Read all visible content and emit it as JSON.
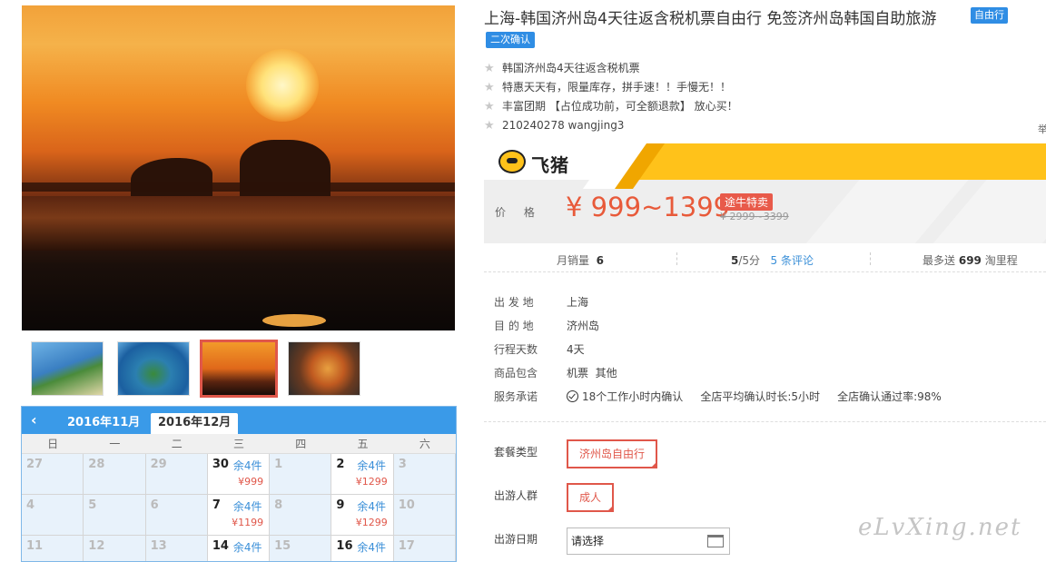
{
  "product": {
    "title": "上海-韩国济州岛4天往返含税机票自由行 免签济州岛韩国自助旅游",
    "badge_free": "自由行",
    "badge_confirm": "二次确认",
    "bullets": [
      "韩国济州岛4天往返含税机票",
      "特惠天天有，限量库存，拼手速！！手慢无！！",
      "丰富团期 【占位成功前，可全额退款】 放心买！",
      "210240278 wangjing3"
    ],
    "edge_text": "举"
  },
  "pricing": {
    "brand_logo_text": "飞猪",
    "label": "价 格",
    "range": "¥ 999~1399",
    "promo_tag": "途牛特卖",
    "original_range": "¥ 2999~3399"
  },
  "stats": {
    "monthly_sales_label": "月销量",
    "monthly_sales_value": "6",
    "rating_value": "5",
    "rating_suffix": "/5分",
    "reviews_count": "5",
    "reviews_label": "条评论",
    "points_prefix": "最多送",
    "points_value": "699",
    "points_suffix": "淘里程"
  },
  "info": [
    {
      "key": "出 发 地",
      "value": "上海"
    },
    {
      "key": "目 的 地",
      "value": "济州岛"
    },
    {
      "key": "行程天数",
      "value": "4天"
    },
    {
      "key": "商品包含",
      "value": "机票  其他"
    },
    {
      "key": "服务承诺",
      "value": "18个工作小时内确认     全店平均确认时长:5小时     全店确认通过率:98%"
    }
  ],
  "options": {
    "package_label": "套餐类型",
    "package_value": "济州岛自由行",
    "group_label": "出游人群",
    "group_value": "成人",
    "date_label": "出游日期",
    "date_placeholder": "请选择"
  },
  "calendar": {
    "prev_icon": "chevron-left-icon",
    "months": [
      "2016年11月",
      "2016年12月"
    ],
    "weekdays": [
      "日",
      "一",
      "二",
      "三",
      "四",
      "五",
      "六"
    ],
    "cells": [
      {
        "d": "27",
        "left": "",
        "price": ""
      },
      {
        "d": "28",
        "left": "",
        "price": ""
      },
      {
        "d": "29",
        "left": "",
        "price": ""
      },
      {
        "d": "30",
        "left": "余4件",
        "price": "¥999"
      },
      {
        "d": "1",
        "left": "",
        "price": ""
      },
      {
        "d": "2",
        "left": "余4件",
        "price": "¥1299"
      },
      {
        "d": "3",
        "left": "",
        "price": ""
      },
      {
        "d": "4",
        "left": "",
        "price": ""
      },
      {
        "d": "5",
        "left": "",
        "price": ""
      },
      {
        "d": "6",
        "left": "",
        "price": ""
      },
      {
        "d": "7",
        "left": "余4件",
        "price": "¥1199"
      },
      {
        "d": "8",
        "left": "",
        "price": ""
      },
      {
        "d": "9",
        "left": "余4件",
        "price": "¥1299"
      },
      {
        "d": "10",
        "left": "",
        "price": ""
      },
      {
        "d": "11",
        "left": "",
        "price": ""
      },
      {
        "d": "12",
        "left": "",
        "price": ""
      },
      {
        "d": "13",
        "left": "",
        "price": ""
      },
      {
        "d": "14",
        "left": "余4件",
        "price": ""
      },
      {
        "d": "15",
        "left": "",
        "price": ""
      },
      {
        "d": "16",
        "left": "余4件",
        "price": ""
      },
      {
        "d": "17",
        "left": "",
        "price": ""
      }
    ]
  },
  "watermark": "eLvXing.net",
  "colors": {
    "accent_blue": "#3a9ae8",
    "price_red": "#e85a3a",
    "feizhu_yellow": "#ffc21a"
  }
}
